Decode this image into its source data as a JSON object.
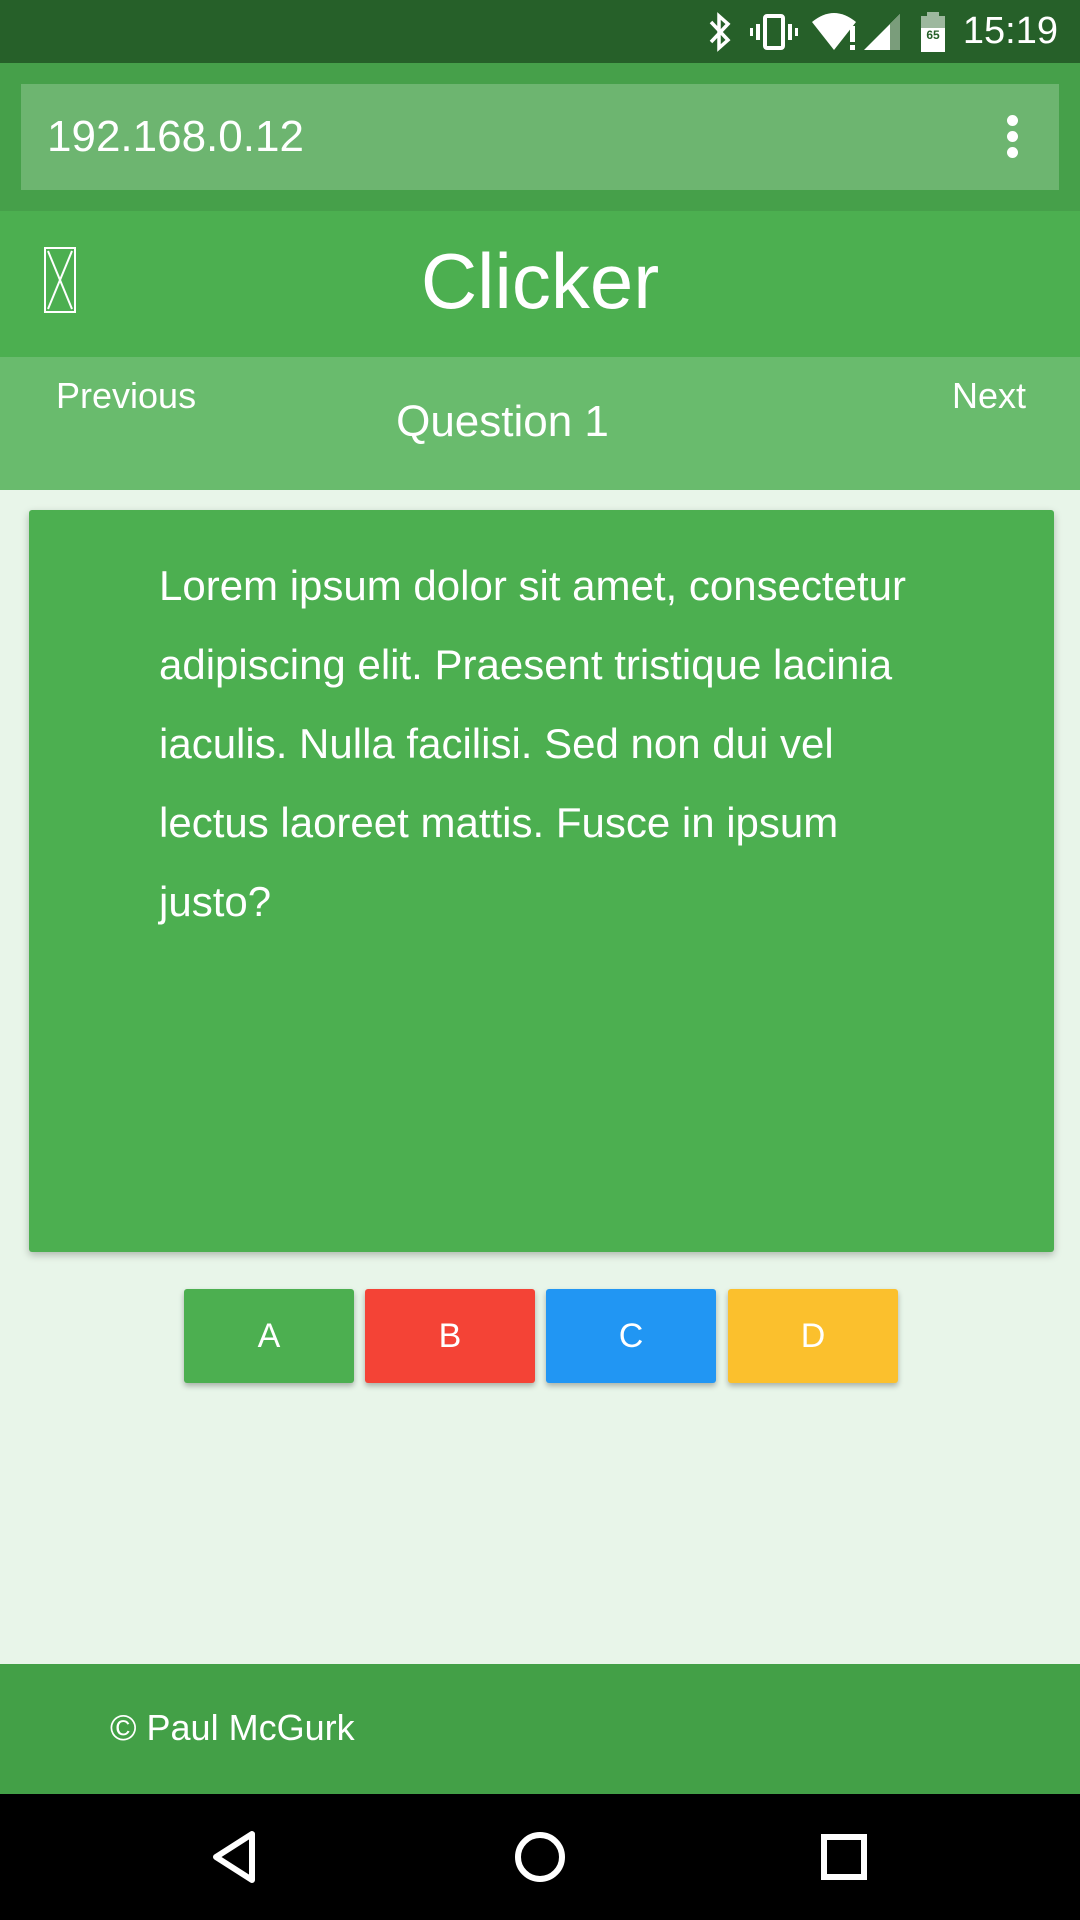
{
  "status_bar": {
    "time": "15:19",
    "battery_level": "65",
    "icons": [
      "bluetooth-icon",
      "vibrate-icon",
      "wifi-alert-icon",
      "cell-signal-icon",
      "battery-icon"
    ]
  },
  "browser": {
    "url": "192.168.0.12",
    "menu_icon": "more-vert-icon"
  },
  "header": {
    "title": "Clicker",
    "logo_icon": "broken-image-icon"
  },
  "question_nav": {
    "previous_label": "Previous",
    "next_label": "Next",
    "question_label": "Question 1"
  },
  "question": {
    "text": "Lorem ipsum dolor sit amet, consectetur adipiscing elit. Praesent tristique lacinia iaculis. Nulla facilisi. Sed non dui vel lectus laoreet mattis. Fusce in ipsum justo?"
  },
  "answers": [
    {
      "label": "A",
      "color": "#4caf50"
    },
    {
      "label": "B",
      "color": "#f44336"
    },
    {
      "label": "C",
      "color": "#2196f3"
    },
    {
      "label": "D",
      "color": "#fbc02d"
    }
  ],
  "footer": {
    "text": "© Paul McGurk"
  },
  "nav_bar": {
    "icons": [
      "back-icon",
      "home-icon",
      "recents-icon"
    ]
  },
  "colors": {
    "primary": "#4caf50",
    "primary_dark": "#266029",
    "primary_light": "#69bb6d",
    "background": "#e8f5e9"
  }
}
